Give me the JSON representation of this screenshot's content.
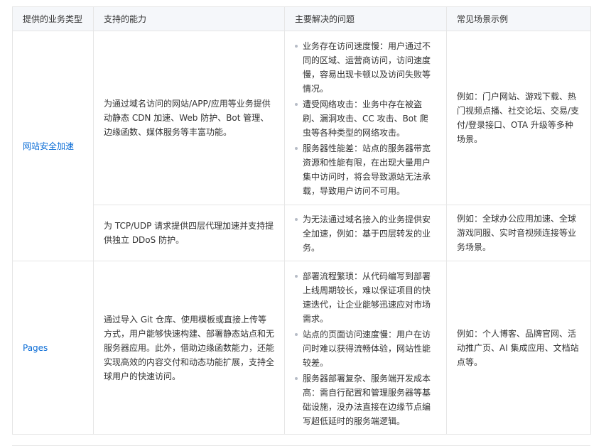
{
  "headers": [
    "提供的业务类型",
    "支持的能力",
    "主要解决的问题",
    "常见场景示例"
  ],
  "rows": {
    "r1": {
      "type": "网站安全加速",
      "abilities": "为通过域名访问的网站/APP/应用等业务提供动静态 CDN 加速、Web 防护、Bot 管理、边缘函数、媒体服务等丰富功能。",
      "problems": [
        "业务存在访问速度慢：用户通过不同的区域、运营商访问，访问速度慢，容易出现卡顿以及访问失败等情况。",
        "遭受网络攻击：业务中存在被盗刷、漏洞攻击、CC 攻击、Bot 爬虫等各种类型的网络攻击。",
        "服务器性能差：站点的服务器带宽资源和性能有限，在出现大量用户集中访问时，将会导致源站无法承载，导致用户访问不可用。"
      ],
      "scenarios": "例如：门户网站、游戏下载、热门视频点播、社交论坛、交易/支付/登录接口、OTA 升级等多种场景。"
    },
    "r2": {
      "abilities": "为 TCP/UDP 请求提供四层代理加速并支持提供独立 DDoS 防护。",
      "problems": [
        "为无法通过域名接入的业务提供安全加速，例如：基于四层转发的业务。"
      ],
      "scenarios": "例如：全球办公应用加速、全球游戏同服、实时音视频连接等业务场景。"
    },
    "r3": {
      "type": "Pages",
      "abilities": "通过导入 Git 仓库、使用模板或直接上传等方式，用户能够快速构建、部署静态站点和无服务器应用。此外，借助边缘函数能力，还能实现高效的内容交付和动态功能扩展，支持全球用户的快速访问。",
      "problems": [
        "部署流程繁琐：从代码编写到部署上线周期较长，难以保证项目的快速迭代，让企业能够迅速应对市场需求。",
        "站点的页面访问速度慢：用户在访问时难以获得流畅体验，网站性能较差。",
        "服务器部署复杂、服务端开发成本高：需自行配置和管理服务器等基础设施，没办法直接在边缘节点编写超低延时的服务端逻辑。"
      ],
      "scenarios": "例如：个人博客、品牌官网、活动推广页、AI 集成应用、文档站点等。"
    }
  }
}
